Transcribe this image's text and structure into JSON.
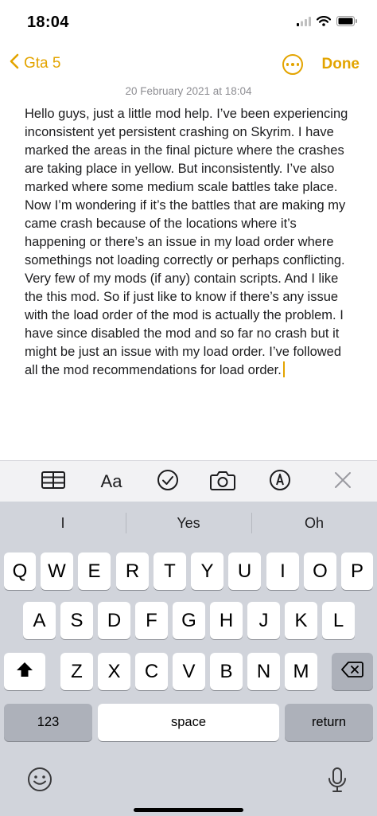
{
  "status_bar": {
    "time": "18:04",
    "signal_icon": "cellular-signal-icon",
    "wifi_icon": "wifi-icon",
    "battery_icon": "battery-icon"
  },
  "nav": {
    "back_label": "Gta 5",
    "back_icon": "chevron-left-icon",
    "more_icon": "ellipsis-circle-icon",
    "done_label": "Done"
  },
  "note": {
    "date": "20 February 2021 at 18:04",
    "body": "Hello guys, just a little mod help. I’ve been experiencing inconsistent yet persistent crashing on Skyrim. I have marked the areas in the final picture where the crashes are taking place in yellow. But inconsistently. I’ve also marked where some medium scale battles take place. Now I’m wondering if it’s the battles that are making my came crash because of the locations where it’s happening or there’s an issue in my load order where somethings not loading correctly or perhaps conflicting. Very few of my mods (if any) contain scripts. And I like the this mod. So if just like to know if there’s any issue with the load order of the mod is actually the problem. I have since disabled the mod and so far no crash but it might be just an issue with my load order. I’ve followed all the mod recommendations for load order."
  },
  "toolbar": {
    "table_icon": "table-icon",
    "format_label": "Aa",
    "checklist_icon": "checklist-icon",
    "camera_icon": "camera-icon",
    "markup_icon": "markup-pen-icon",
    "close_icon": "close-icon"
  },
  "keyboard": {
    "suggestions": [
      "I",
      "Yes",
      "Oh"
    ],
    "row1": [
      "Q",
      "W",
      "E",
      "R",
      "T",
      "Y",
      "U",
      "I",
      "O",
      "P"
    ],
    "row2": [
      "A",
      "S",
      "D",
      "F",
      "G",
      "H",
      "J",
      "K",
      "L"
    ],
    "row3": [
      "Z",
      "X",
      "C",
      "V",
      "B",
      "N",
      "M"
    ],
    "numbers_label": "123",
    "space_label": "space",
    "return_label": "return",
    "shift_icon": "shift-icon",
    "delete_icon": "delete-backspace-icon",
    "emoji_icon": "emoji-icon",
    "mic_icon": "microphone-icon"
  },
  "colors": {
    "accent": "#e3a400",
    "keyboard_bg": "#d1d4db",
    "special_key": "#adb1ba"
  }
}
